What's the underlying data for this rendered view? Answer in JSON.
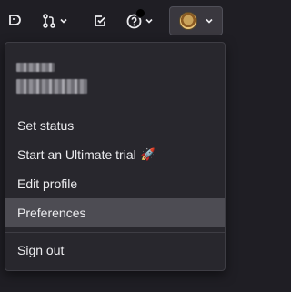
{
  "topbar": {
    "icons": [
      "issues-icon",
      "merge-request-icon",
      "todo-icon",
      "help-icon",
      "avatar"
    ]
  },
  "menu": {
    "set_status": "Set status",
    "ultimate_trial": "Start an Ultimate trial",
    "ultimate_trial_emoji": "🚀",
    "edit_profile": "Edit profile",
    "preferences": "Preferences",
    "sign_out": "Sign out"
  },
  "colors": {
    "background": "#1f1e24",
    "dropdown": "#28272d",
    "highlight": "#4d4c53",
    "text": "#ececef"
  }
}
